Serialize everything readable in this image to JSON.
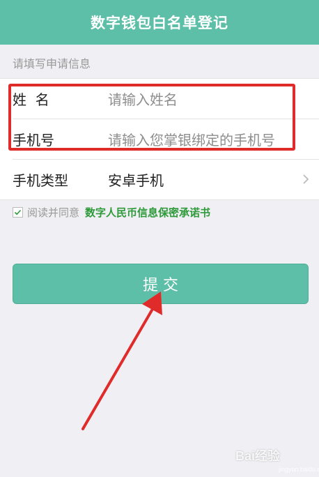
{
  "header": {
    "title": "数字钱包白名单登记"
  },
  "form": {
    "section_hint": "请填写申请信息",
    "name": {
      "label": "姓  名",
      "placeholder": "请输入姓名"
    },
    "phone": {
      "label": "手机号",
      "placeholder": "请输入您掌银绑定的手机号"
    },
    "phone_type": {
      "label": "手机类型",
      "value": "安卓手机"
    }
  },
  "agreement": {
    "text": "阅读并同意",
    "link": "数字人民币信息保密承诺书",
    "checked": true
  },
  "submit": {
    "label": "提 交"
  },
  "annotation": {
    "highlight_color": "#e02b2b",
    "arrow_color": "#e02b2b"
  },
  "watermark": {
    "text": "Bai经验",
    "sub": "jingyan.baidu.com"
  }
}
